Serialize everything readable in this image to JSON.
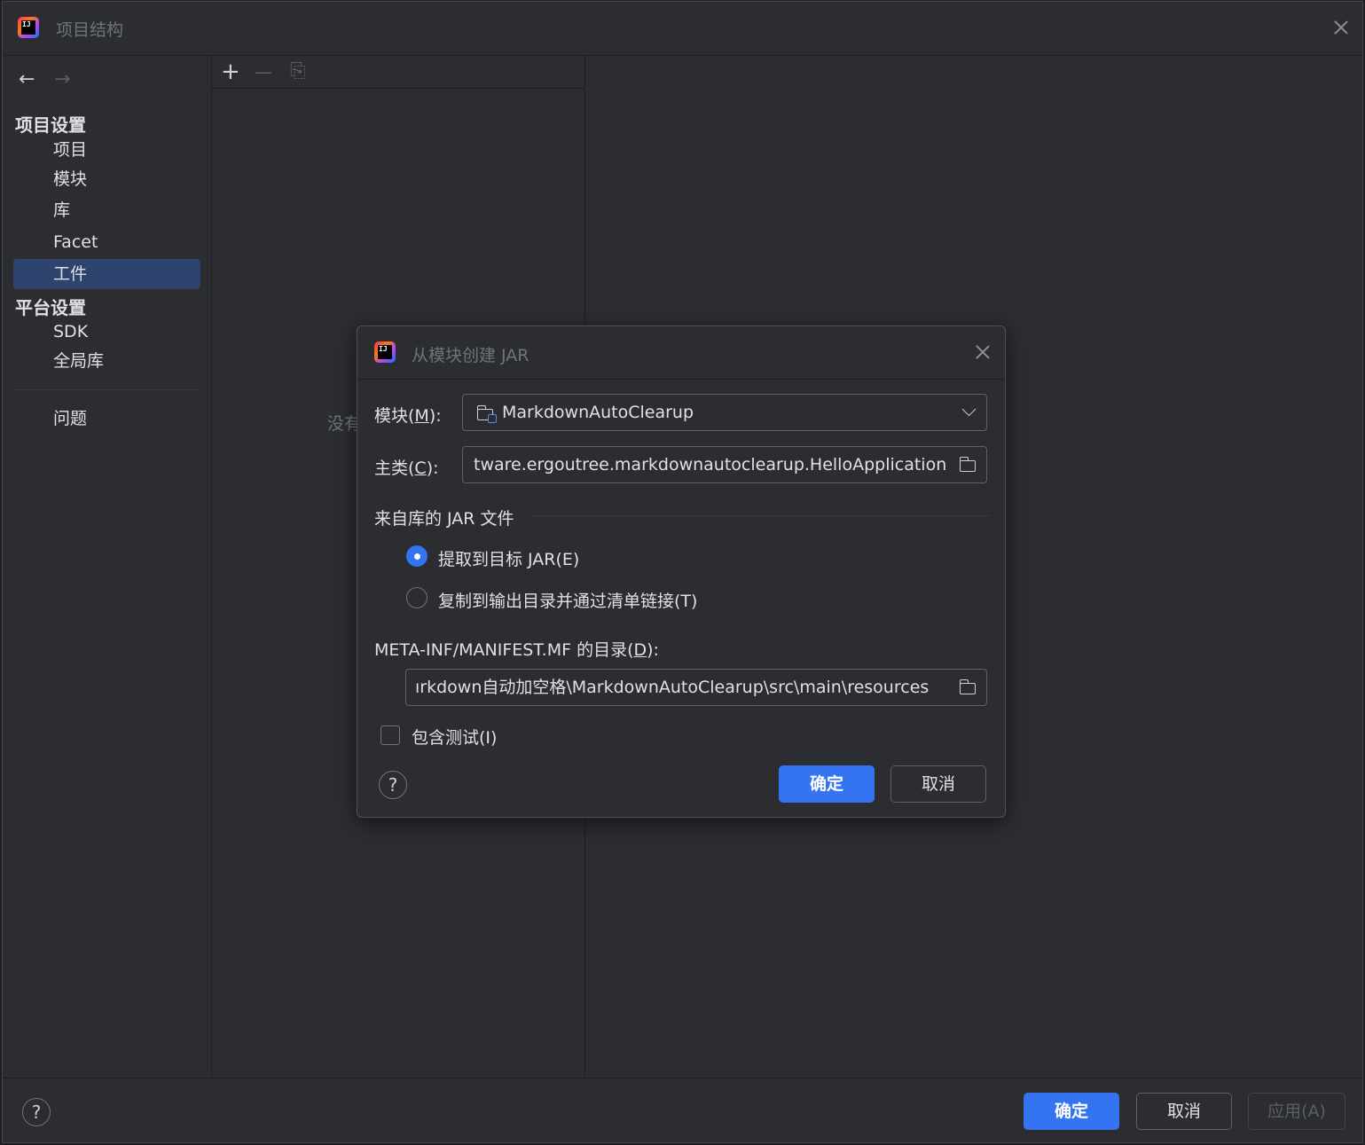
{
  "window": {
    "title": "项目结构",
    "close_label": "×"
  },
  "sidebar": {
    "back": "←",
    "forward": "→",
    "project_settings": {
      "title": "项目设置",
      "items": [
        {
          "label": "项目"
        },
        {
          "label": "模块"
        },
        {
          "label": "库"
        },
        {
          "label": "Facet"
        },
        {
          "label": "工件",
          "selected": true
        }
      ]
    },
    "platform_settings": {
      "title": "平台设置",
      "items": [
        {
          "label": "SDK"
        },
        {
          "label": "全局库"
        }
      ]
    },
    "problems": "问题"
  },
  "toolbar": {
    "add": "+",
    "remove": "—",
    "copy": "⎘"
  },
  "middle": {
    "empty_text": "没有"
  },
  "bottom": {
    "help": "?",
    "ok": "确定",
    "cancel": "取消",
    "apply": "应用(A)"
  },
  "dialog": {
    "title": "从模块创建 JAR",
    "module_label_prefix": "模块(",
    "module_mnemonic": "M",
    "module_label_suffix": "):",
    "module_value": "MarkdownAutoClearup",
    "main_class_label_prefix": "主类(",
    "main_class_mnemonic": "C",
    "main_class_label_suffix": "):",
    "main_class_value": "tware.ergoutree.markdownautoclearup.HelloApplication",
    "jar_group_title": "来自库的 JAR 文件",
    "options": [
      {
        "label": "提取到目标 JAR(E)",
        "selected": true
      },
      {
        "label": "复制到输出目录并通过清单链接(T)",
        "selected": false
      }
    ],
    "manifest_label_prefix": "META-INF/MANIFEST.MF 的目录(",
    "manifest_mnemonic": "D",
    "manifest_label_suffix": "):",
    "manifest_value": "ırkdown自动加空格\\MarkdownAutoClearup\\src\\main\\resources",
    "include_tests_label": "包含测试(I)",
    "include_tests_checked": false,
    "help": "?",
    "ok": "确定",
    "cancel": "取消"
  },
  "colors": {
    "accent": "#3574f0",
    "selection": "#2e436e",
    "background": "#2b2d30"
  }
}
